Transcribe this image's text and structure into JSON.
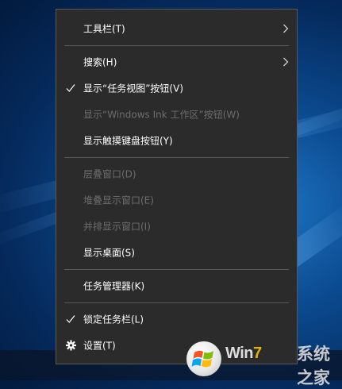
{
  "menu": {
    "items": [
      {
        "label": "工具栏(T)",
        "enabled": true,
        "checked": false,
        "submenu": true,
        "icon": ""
      },
      {
        "label": "搜索(H)",
        "enabled": true,
        "checked": false,
        "submenu": true,
        "icon": ""
      },
      {
        "label": "显示“任务视图”按钮(V)",
        "enabled": true,
        "checked": true,
        "submenu": false,
        "icon": "checkmark-icon"
      },
      {
        "label": "显示“Windows Ink 工作区”按钮(W)",
        "enabled": false,
        "checked": false,
        "submenu": false,
        "icon": ""
      },
      {
        "label": "显示触摸键盘按钮(Y)",
        "enabled": true,
        "checked": false,
        "submenu": false,
        "icon": ""
      },
      {
        "label": "层叠窗口(D)",
        "enabled": false,
        "checked": false,
        "submenu": false,
        "icon": ""
      },
      {
        "label": "堆叠显示窗口(E)",
        "enabled": false,
        "checked": false,
        "submenu": false,
        "icon": ""
      },
      {
        "label": "并排显示窗口(I)",
        "enabled": false,
        "checked": false,
        "submenu": false,
        "icon": ""
      },
      {
        "label": "显示桌面(S)",
        "enabled": true,
        "checked": false,
        "submenu": false,
        "icon": ""
      },
      {
        "label": "任务管理器(K)",
        "enabled": true,
        "checked": false,
        "submenu": false,
        "icon": ""
      },
      {
        "label": "锁定任务栏(L)",
        "enabled": true,
        "checked": true,
        "submenu": false,
        "icon": "checkmark-icon"
      },
      {
        "label": "设置(T)",
        "enabled": true,
        "checked": false,
        "submenu": false,
        "icon": "gear-icon"
      }
    ]
  },
  "watermark": {
    "brand_win": "Win",
    "brand_seven": "7",
    "brand_suffix": "系统之家"
  },
  "colors": {
    "menu_bg": "#2b2b2b",
    "menu_text": "#ffffff",
    "disabled_text": "#6d6d6d",
    "separator": "#5a5a5a"
  }
}
